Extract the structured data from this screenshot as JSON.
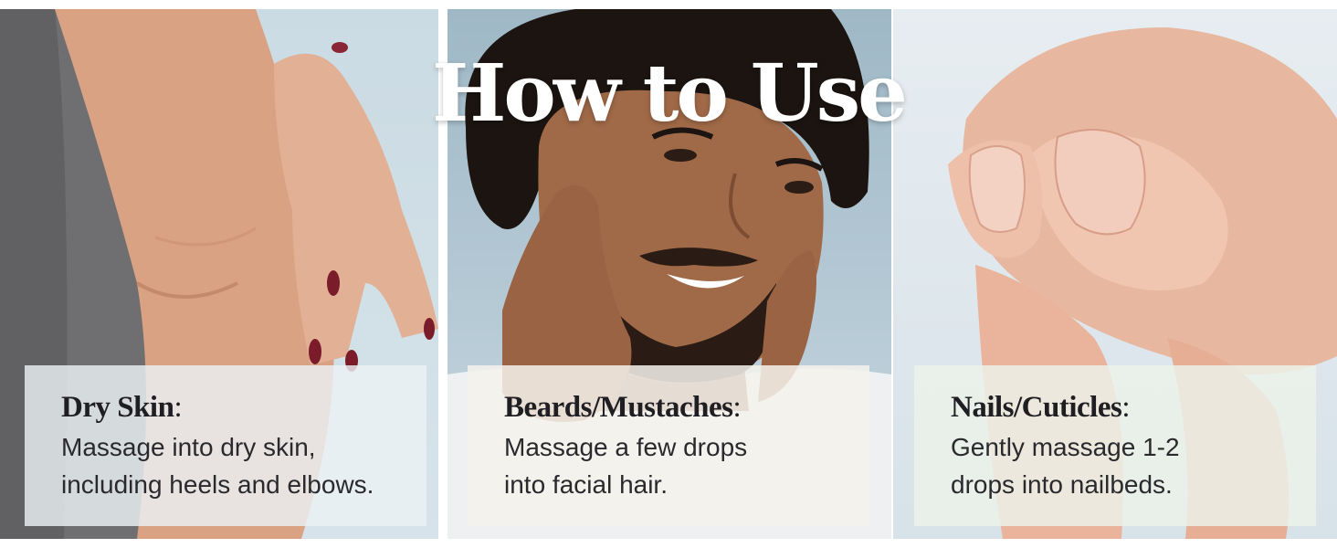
{
  "title": "How to Use",
  "cards": [
    {
      "heading": "Dry Skin",
      "line1": "Massage into dry skin,",
      "line2": "including heels and elbows."
    },
    {
      "heading": "Beards/Mustaches",
      "line1": "Massage a few drops",
      "line2": "into facial hair."
    },
    {
      "heading": "Nails/Cuticles",
      "line1": "Gently massage 1-2",
      "line2": "drops into nailbeds."
    }
  ],
  "colors": {
    "title": "#ffffff",
    "heading": "#1f1f23",
    "body_text": "#2a2a2e",
    "card_overlay": "#ecf2f4"
  }
}
